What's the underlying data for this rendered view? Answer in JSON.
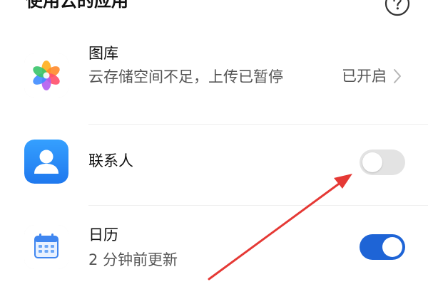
{
  "section": {
    "title": "使用云的应用",
    "help_icon": "question-circle-icon"
  },
  "apps": [
    {
      "name": "图库",
      "subtitle": "云存储空间不足，上传已暂停",
      "status": "已开启",
      "control": "chevron",
      "icon": "gallery-flower-icon"
    },
    {
      "name": "联系人",
      "control": "toggle",
      "enabled": false,
      "icon": "contacts-person-icon"
    },
    {
      "name": "日历",
      "subtitle": "2 分钟前更新",
      "control": "toggle",
      "enabled": true,
      "icon": "calendar-icon"
    }
  ],
  "colors": {
    "toggle_on": "#1e64d6",
    "toggle_off": "#e3e3e3",
    "annotation_arrow": "#e53935",
    "contacts_icon_bg": "#2a8af6"
  }
}
